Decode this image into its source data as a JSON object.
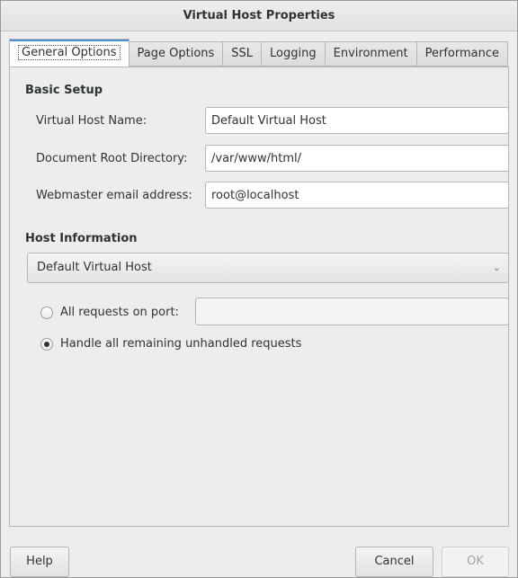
{
  "window": {
    "title": "Virtual Host Properties"
  },
  "tabs": [
    {
      "label": "General Options"
    },
    {
      "label": "Page Options"
    },
    {
      "label": "SSL"
    },
    {
      "label": "Logging"
    },
    {
      "label": "Environment"
    },
    {
      "label": "Performance"
    }
  ],
  "basic_setup": {
    "title": "Basic Setup",
    "virtual_host_name": {
      "label": "Virtual Host Name:",
      "value": "Default Virtual Host"
    },
    "document_root": {
      "label": "Document Root Directory:",
      "value": "/var/www/html/"
    },
    "webmaster_email": {
      "label": "Webmaster email address:",
      "value": "root@localhost"
    }
  },
  "host_information": {
    "title": "Host Information",
    "combo_value": "Default Virtual Host",
    "radio_port_label": "All requests on port:",
    "port_value": "",
    "radio_remaining_label": "Handle all remaining unhandled requests",
    "selected_option": "remaining"
  },
  "buttons": {
    "help": "Help",
    "cancel": "Cancel",
    "ok": "OK"
  },
  "icons": {
    "combo_arrow": "chevron-down-icon"
  }
}
